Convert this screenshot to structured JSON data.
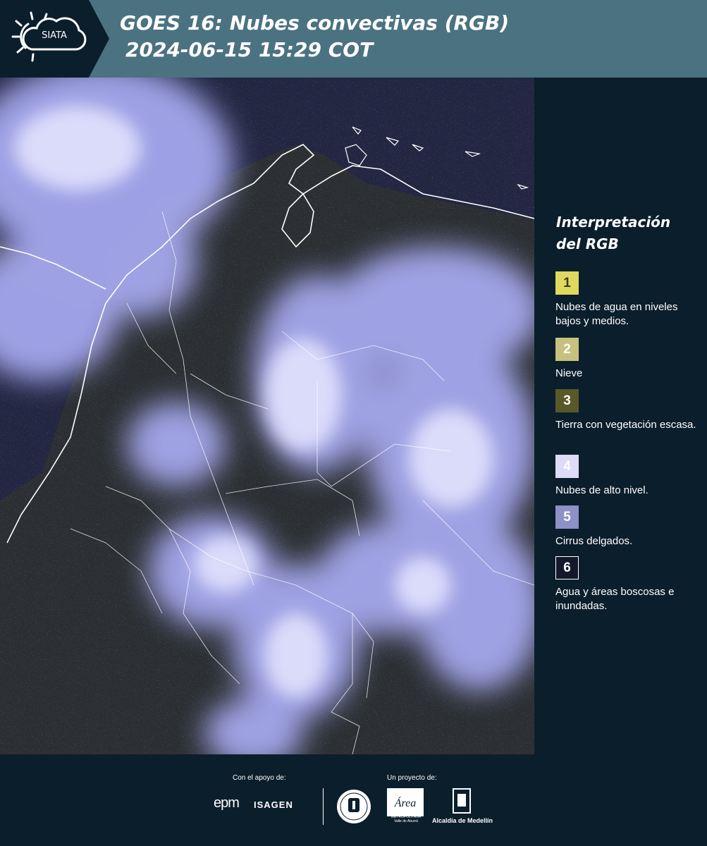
{
  "header": {
    "logo_text": "SIATA",
    "title_line1": "GOES 16: Nubes convectivas (RGB)",
    "title_line2": "2024-06-15 15:29 COT",
    "background_color": "#4b7281",
    "logo_block_color": "#0b1e2b"
  },
  "map": {
    "type": "satellite-rgb-image",
    "ocean_color": "#232543",
    "cloud_color": "#b7b9ff",
    "land_color": "#2c3034",
    "low_cloud_color": "#cfcf6a",
    "boundary_color": "#ffffff"
  },
  "legend": {
    "title": "Interpretación del RGB",
    "items": [
      {
        "number": "1",
        "label": "Nubes de agua en niveles bajos y medios.",
        "color": "#dfd95f",
        "text_color": "#3a3a20"
      },
      {
        "number": "2",
        "label": "Nieve",
        "color": "#c8c07f",
        "text_color": "#ffffff"
      },
      {
        "number": "3",
        "label": "Tierra con vegetación escasa.",
        "color": "#585928",
        "text_color": "#ffffff"
      },
      {
        "number": "4",
        "label": "Nubes de alto nivel.",
        "color": "#dcdcf8",
        "text_color": "#ffffff"
      },
      {
        "number": "5",
        "label": "Cirrus delgados.",
        "color": "#8e90c8",
        "text_color": "#ffffff"
      },
      {
        "number": "6",
        "label": "Agua y áreas boscosas e inundadas.",
        "color": "#13182a",
        "text_color": "#ffffff"
      }
    ]
  },
  "footer": {
    "support_caption": "Con el apoyo de:",
    "project_caption": "Un proyecto de:",
    "logo_epm": "epm",
    "logo_isagen": "ISAGEN",
    "logo_area": "Área",
    "logo_area_sub": "METROPOLITANA Valle de Aburrá",
    "logo_alcaldia": "Alcaldía de Medellín"
  }
}
